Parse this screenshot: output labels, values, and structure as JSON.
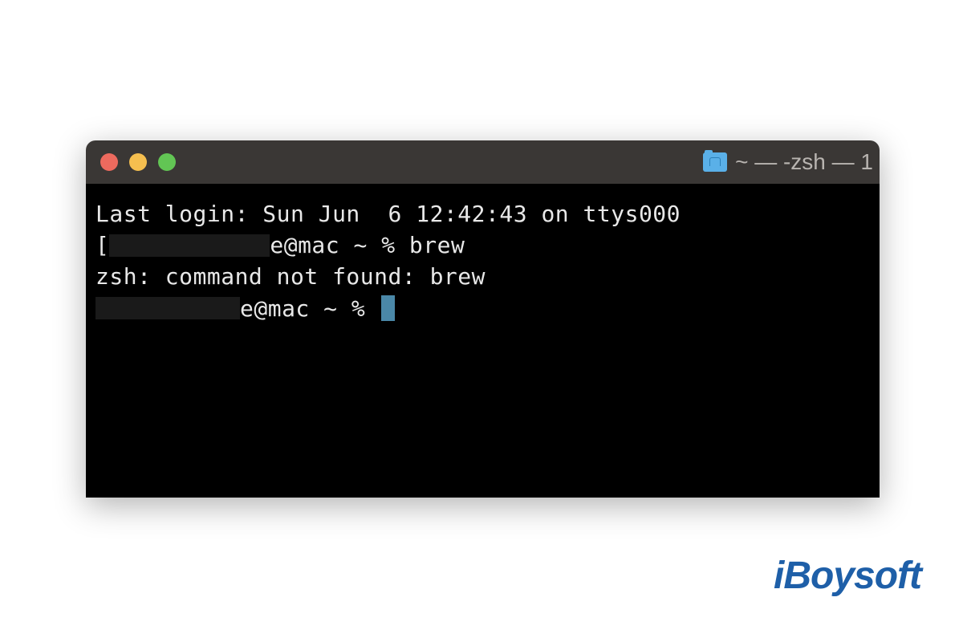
{
  "window": {
    "title_text": "~ — -zsh — 1"
  },
  "terminal": {
    "line1": "Last login: Sun Jun  6 12:42:43 on ttys000",
    "line2_visible_prefix_char": "[",
    "line2_after_redact": "e@mac ~ % brew",
    "line3": "zsh: command not found: brew",
    "line4_after_redact": "e@mac ~ % "
  },
  "watermark": {
    "text": "iBoysoft"
  }
}
